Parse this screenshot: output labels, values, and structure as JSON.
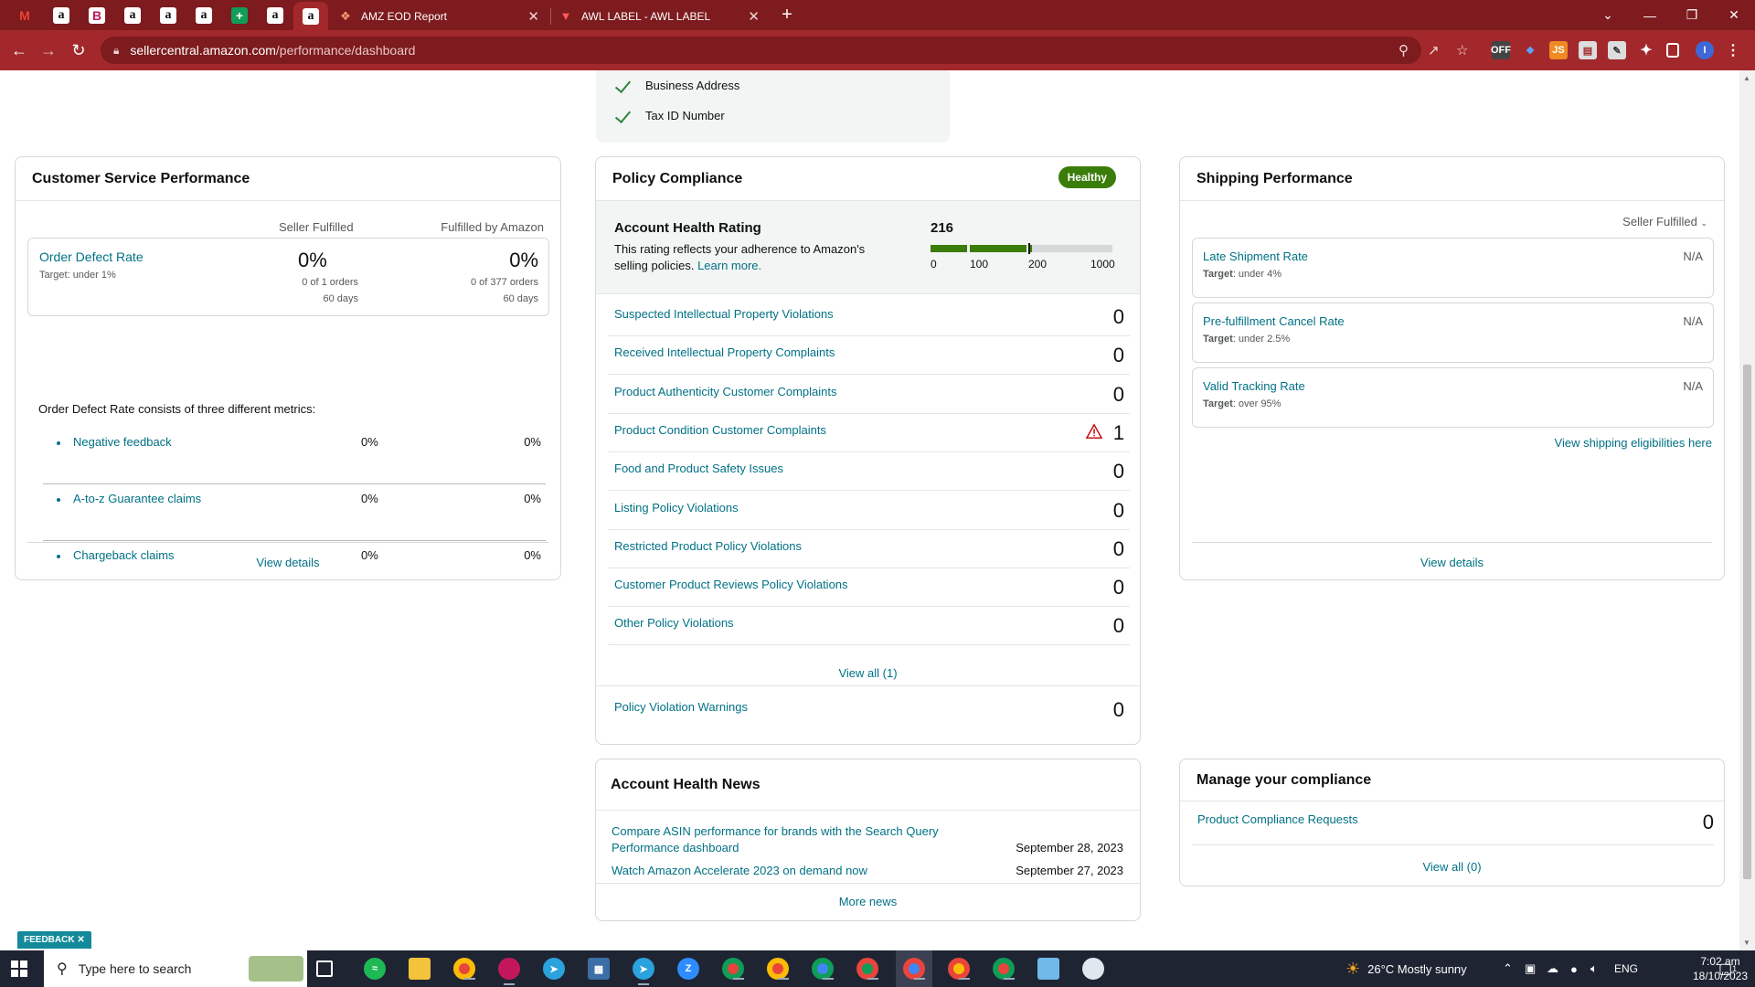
{
  "browser": {
    "pinned_tabs": [
      {
        "icon": "gmail-icon",
        "glyph": "M"
      },
      {
        "icon": "amazon-icon",
        "glyph": "a"
      },
      {
        "icon": "b-app-icon",
        "glyph": "B"
      },
      {
        "icon": "amazon-icon",
        "glyph": "a"
      },
      {
        "icon": "amazon-icon",
        "glyph": "a"
      },
      {
        "icon": "amazon-icon",
        "glyph": "a"
      },
      {
        "icon": "sheets-icon",
        "glyph": "+"
      },
      {
        "icon": "amazon-icon",
        "glyph": "a"
      },
      {
        "icon": "amazon-icon",
        "glyph": "a"
      }
    ],
    "tabs": [
      {
        "title": "AMZ EOD Report"
      },
      {
        "title": "AWL LABEL - AWL LABEL"
      }
    ],
    "url_host": "sellercentral.amazon.com",
    "url_path": "/performance/dashboard",
    "profile_initial": "I",
    "colors": {
      "frame": "#7d1b1e",
      "toolbar": "#a3282c"
    }
  },
  "verification": {
    "items": [
      "Business Address",
      "Tax ID Number"
    ]
  },
  "customer_service": {
    "title": "Customer Service Performance",
    "col_seller": "Seller Fulfilled",
    "col_fba": "Fulfilled by Amazon",
    "odr": {
      "label": "Order Defect Rate",
      "target_label": "Target",
      "target_value": ": under 1%",
      "seller_pct": "0%",
      "seller_orders": "0 of 1 orders",
      "seller_days": "60 days",
      "fba_pct": "0%",
      "fba_orders": "0 of 377 orders",
      "fba_days": "60 days"
    },
    "intro": "Order Defect Rate consists of three different metrics:",
    "metrics": [
      {
        "label": "Negative feedback",
        "seller": "0%",
        "fba": "0%"
      },
      {
        "label": "A-to-z Guarantee claims",
        "seller": "0%",
        "fba": "0%"
      },
      {
        "label": "Chargeback claims",
        "seller": "0%",
        "fba": "0%"
      }
    ],
    "view_details": "View details"
  },
  "policy": {
    "title": "Policy Compliance",
    "badge": "Healthy",
    "ahr_title": "Account Health Rating",
    "ahr_desc": "This rating reflects your adherence to Amazon's selling policies.",
    "learn_more": "Learn more.",
    "score": "216",
    "score_value": 216,
    "ticks": [
      "0",
      "100",
      "200",
      "1000"
    ],
    "rows": [
      {
        "label": "Suspected Intellectual Property Violations",
        "value": "0",
        "warning": false
      },
      {
        "label": "Received Intellectual Property Complaints",
        "value": "0",
        "warning": false
      },
      {
        "label": "Product Authenticity Customer Complaints",
        "value": "0",
        "warning": false
      },
      {
        "label": "Product Condition Customer Complaints",
        "value": "1",
        "warning": true
      },
      {
        "label": "Food and Product Safety Issues",
        "value": "0",
        "warning": false
      },
      {
        "label": "Listing Policy Violations",
        "value": "0",
        "warning": false
      },
      {
        "label": "Restricted Product Policy Violations",
        "value": "0",
        "warning": false
      },
      {
        "label": "Customer Product Reviews Policy Violations",
        "value": "0",
        "warning": false
      },
      {
        "label": "Other Policy Violations",
        "value": "0",
        "warning": false
      }
    ],
    "view_all": "View all (1)",
    "warnings_label": "Policy Violation Warnings",
    "warnings_value": "0",
    "colors": {
      "healthy": "#3b7d0a"
    }
  },
  "shipping": {
    "title": "Shipping Performance",
    "filter": "Seller Fulfilled",
    "metrics": [
      {
        "label": "Late Shipment Rate",
        "target_label": "Target",
        "target_value": ": under 4%",
        "value": "N/A"
      },
      {
        "label": "Pre-fulfillment Cancel Rate",
        "target_label": "Target",
        "target_value": ": under 2.5%",
        "value": "N/A"
      },
      {
        "label": "Valid Tracking Rate",
        "target_label": "Target",
        "target_value": ": over 95%",
        "value": "N/A"
      }
    ],
    "eligibilities": "View shipping eligibilities here",
    "view_details": "View details"
  },
  "news": {
    "title": "Account Health News",
    "items": [
      {
        "title": "Compare ASIN performance for brands with the Search Query Performance dashboard",
        "date": "September 28, 2023"
      },
      {
        "title": "Watch Amazon Accelerate 2023 on demand now",
        "date": "September 27, 2023"
      }
    ],
    "more": "More news"
  },
  "manage": {
    "title": "Manage your compliance",
    "row_label": "Product Compliance Requests",
    "row_value": "0",
    "view_all": "View all (0)"
  },
  "feedback": "FEEDBACK",
  "taskbar": {
    "search_placeholder": "Type here to search",
    "weather": "26°C  Mostly sunny",
    "lang": "ENG",
    "time": "7:02 am",
    "date": "18/10/2023",
    "notifications": "1"
  }
}
